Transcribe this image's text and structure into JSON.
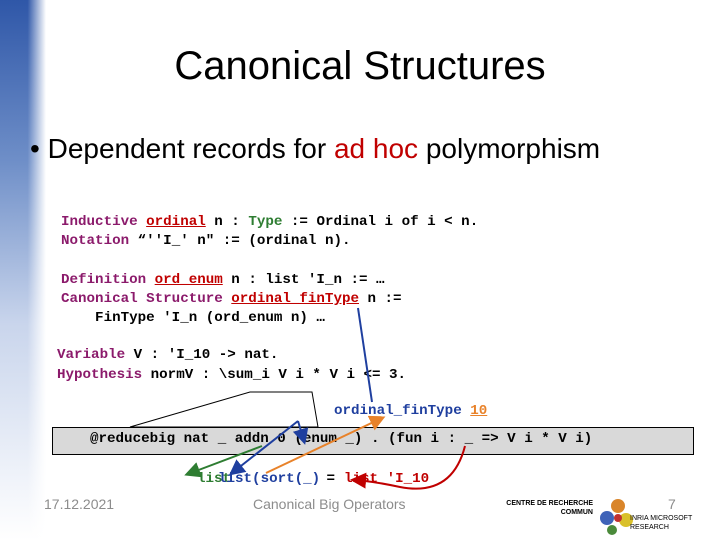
{
  "title": "Canonical Structures",
  "bullet": {
    "pre": "Dependent records for ",
    "highlight": "ad hoc",
    "post": " polymorphism"
  },
  "code": {
    "l1": {
      "kw": "Inductive",
      "name": "ordinal",
      "a": " n : ",
      "type": "Type",
      "b": " := Ordinal i of i < n."
    },
    "l2": {
      "kw": "Notation",
      "rest": " “''I_' n\" := (ordinal n)."
    },
    "l3": {
      "kw": "Definition",
      "name": "ord_enum",
      "rest": " n : list 'I_n := …"
    },
    "l4": {
      "kw": "Canonical Structure",
      "name": "ordinal_finType",
      "rest": " n :="
    },
    "l5": {
      "rest": "    FinType 'I_n (ord_enum n) …"
    },
    "l6": {
      "kw": "Variable",
      "rest": " V : 'I_10 -> nat."
    },
    "l7": {
      "kw": "Hypothesis",
      "rest": " normV : \\sum_i V i * V i <= 3."
    }
  },
  "callout": {
    "name": "ordinal_finType",
    "arg": "10"
  },
  "box_text": "@reducebig nat _ addn 0 (enum _) . (fun i : _ => V i * V i)",
  "bottom": {
    "green": "list",
    "blue": "list(sort(_)",
    "eq": " = ",
    "red": "list 'I_10"
  },
  "footer": {
    "date": "17.12.2021",
    "center": "Canonical Big Operators",
    "page": "7",
    "logo_top": "CENTRE DE RECHERCHE COMMUN",
    "logo_bottom": "INRIA MICROSOFT RESEARCH"
  },
  "colors": {
    "keyword": "#8b1a6b",
    "definition": "#c00000",
    "type": "#2e7d32",
    "blue": "#1f3f9f",
    "orange": "#e8822a"
  }
}
